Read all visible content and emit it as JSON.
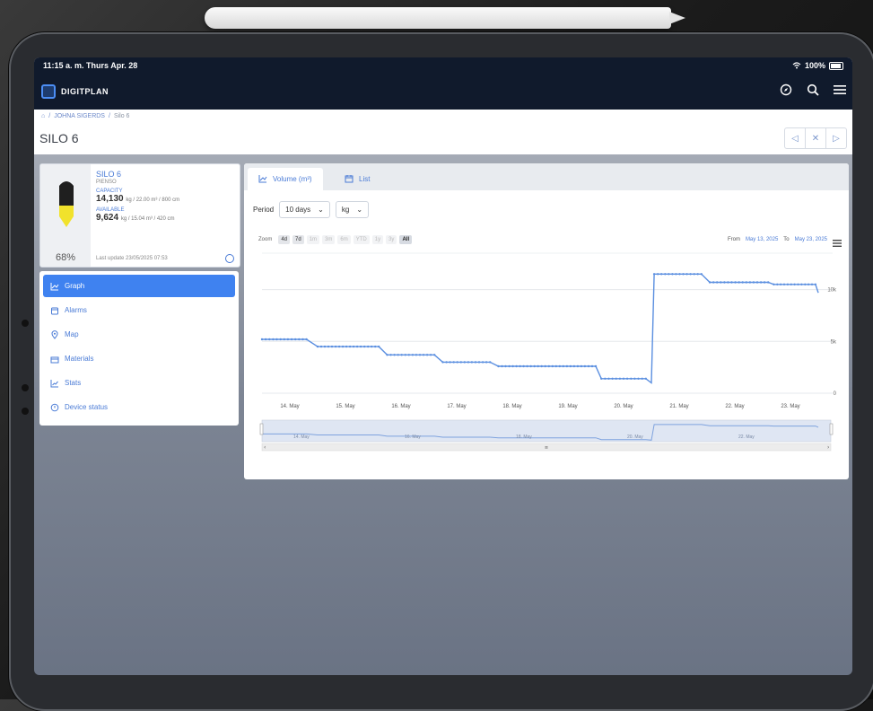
{
  "status": {
    "time": "11:15 a. m. Thurs Apr. 28",
    "battery": "100%"
  },
  "app": {
    "brand": "DIGITPLAN"
  },
  "breadcrumb": {
    "home": "⌂",
    "parent": "JOHNA SIGERDS",
    "current": "Silo 6",
    "sep": "/"
  },
  "page": {
    "title": "SILO 6"
  },
  "nav": {
    "prev": "◁",
    "close": "✕",
    "next": "▷"
  },
  "silo": {
    "name": "SILO 6",
    "subtitle": "PIENSO",
    "capacity_label": "CAPACITY",
    "capacity_value": "14,130",
    "capacity_unit": "kg / 22.00 m³ / 800 cm",
    "available_label": "AVAILABLE",
    "available_value": "9,624",
    "available_unit": "kg / 15.04 m³ / 420 cm",
    "percent": "68%",
    "fill_fraction": 0.68,
    "last_update": "Last update 23/05/2025 07:53",
    "colors": {
      "fill": "#f1e22c",
      "body": "#1f1f1f"
    }
  },
  "menu": {
    "items": [
      {
        "label": "Graph",
        "icon": "chart-icon",
        "active": true
      },
      {
        "label": "Alarms",
        "icon": "alarm-icon",
        "active": false
      },
      {
        "label": "Map",
        "icon": "map-pin-icon",
        "active": false
      },
      {
        "label": "Materials",
        "icon": "materials-icon",
        "active": false
      },
      {
        "label": "Stats",
        "icon": "stats-icon",
        "active": false
      },
      {
        "label": "Device status",
        "icon": "device-status-icon",
        "active": false
      }
    ]
  },
  "tabs": {
    "volume": "Volume (m³)",
    "list": "List"
  },
  "controls": {
    "period_label": "Period",
    "period_value": "10 days",
    "unit_value": "kg"
  },
  "zoom": {
    "label": "Zoom",
    "options": [
      "4d",
      "7d",
      "1m",
      "3m",
      "6m",
      "YTD",
      "1y",
      "3y",
      "All"
    ],
    "enabled": [
      "4d",
      "7d",
      "All"
    ],
    "selected": "All"
  },
  "range": {
    "from_label": "From",
    "from": "May 13, 2025",
    "to_label": "To",
    "to": "May 23, 2025"
  },
  "chart_data": {
    "type": "line",
    "x_labels": [
      "14. May",
      "15. May",
      "16. May",
      "17. May",
      "18. May",
      "19. May",
      "20. May",
      "21. May",
      "22. May",
      "23. May"
    ],
    "y_labels": [
      "0",
      "5k",
      "10k"
    ],
    "ylim": [
      0,
      13000
    ],
    "xlim": [
      13.5,
      23.5
    ],
    "series": [
      {
        "color": "#5b8fe0",
        "points": [
          [
            13.5,
            5200
          ],
          [
            14.3,
            5200
          ],
          [
            14.5,
            4500
          ],
          [
            15.6,
            4500
          ],
          [
            15.75,
            3700
          ],
          [
            16.6,
            3700
          ],
          [
            16.75,
            3000
          ],
          [
            17.6,
            3000
          ],
          [
            17.75,
            2600
          ],
          [
            19.5,
            2600
          ],
          [
            19.6,
            1400
          ],
          [
            20.4,
            1400
          ],
          [
            20.5,
            1000
          ],
          [
            20.55,
            11500
          ],
          [
            21.4,
            11500
          ],
          [
            21.55,
            10700
          ],
          [
            22.6,
            10700
          ],
          [
            22.7,
            10500
          ],
          [
            23.45,
            10500
          ],
          [
            23.5,
            9700
          ]
        ]
      }
    ],
    "navigator_labels": [
      "14. May",
      "16. May",
      "18. May",
      "20. May",
      "22. May"
    ],
    "grid": true,
    "legend": "none"
  },
  "colors": {
    "accent": "#3f82f0",
    "link": "#4a7bd6",
    "appbar": "#101a2c"
  }
}
